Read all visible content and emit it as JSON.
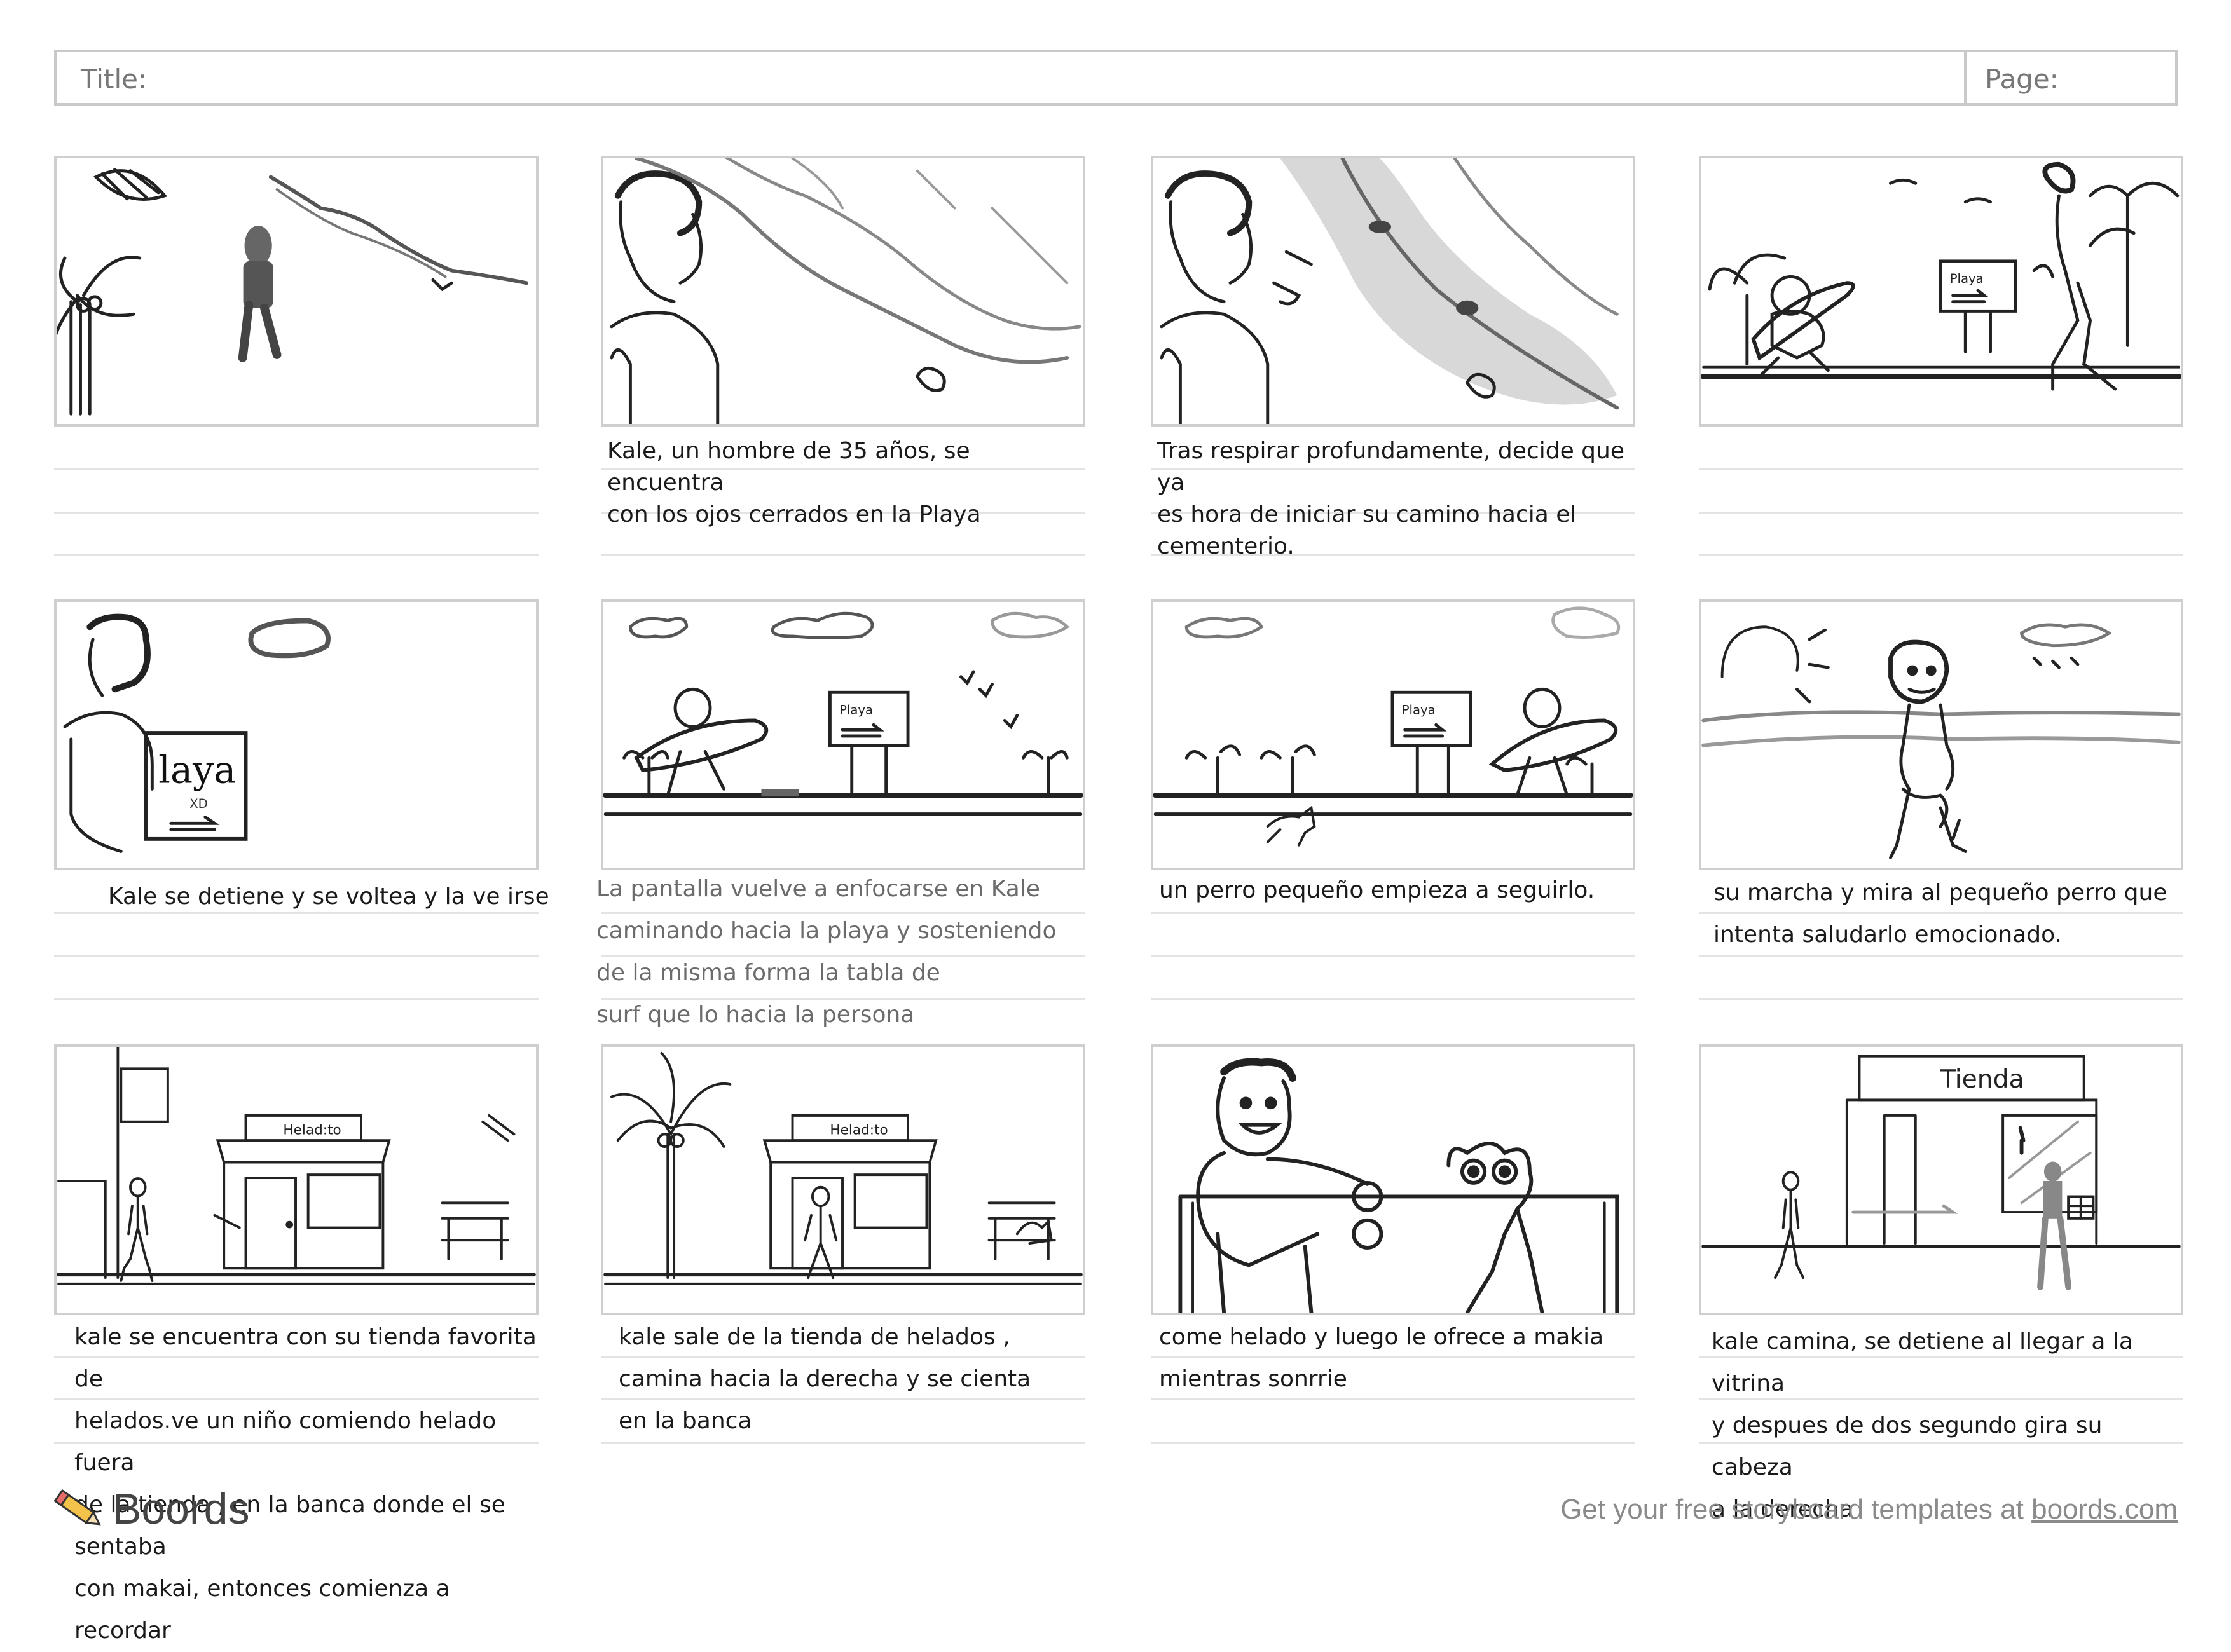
{
  "header": {
    "title_label": "Title:",
    "page_label": "Page:"
  },
  "panels": [
    {
      "caption": ""
    },
    {
      "caption": "Kale, un hombre de 35 años, se encuentra\ncon los ojos cerrados en la Playa"
    },
    {
      "caption": "Tras respirar profundamente, decide que ya\nes hora de iniciar su camino hacia el\ncementerio."
    },
    {
      "caption": ""
    },
    {
      "caption": "Kale se detiene y se voltea y la ve irse",
      "sign_text": "laya",
      "sign_sub": "XD"
    },
    {
      "caption": "La pantalla vuelve a enfocarse en Kale\ncaminando hacia la playa y sosteniendo\n de la misma forma la tabla de\n surf que lo hacia la persona",
      "sign_text": "Playa"
    },
    {
      "caption": "un perro pequeño empieza a seguirlo.",
      "sign_text": "Playa"
    },
    {
      "caption": "su marcha y mira al pequeño perro que\nintenta saludarlo emocionado."
    },
    {
      "caption": "kale se encuentra con su tienda favorita de\nhelados.ve un niño comiendo helado fuera\nde la tienda , en la banca donde el se sentaba\n con  makai,  entonces comienza a recordar",
      "shop_sign": "Helad:to"
    },
    {
      "caption": "kale sale de la tienda de helados ,\ncamina hacia la derecha y se cienta\nen la banca",
      "shop_sign": "Helad:to"
    },
    {
      "caption": "come helado y luego le ofrece a makia\n mientras sonrrie"
    },
    {
      "caption": "kale camina, se detiene al llegar a la vitrina\n y despues de dos segundo gira su cabeza\na la derecha",
      "shop_sign": "Tienda"
    }
  ],
  "footer": {
    "brand": "Boords",
    "promo_text": "Get your free storyboard templates at ",
    "promo_link": "boords.com"
  }
}
